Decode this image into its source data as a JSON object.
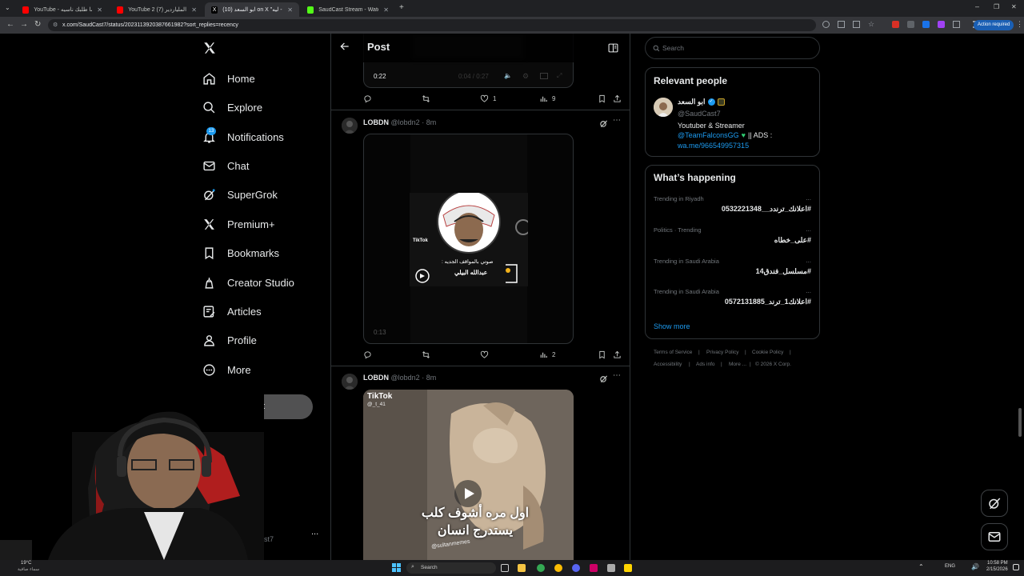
{
  "browser": {
    "tabs": [
      {
        "label": "YouTube - ما طلبك ناسيه",
        "active": false,
        "icon": "youtube-icon"
      },
      {
        "label": "YouTube 2 (7) تحدي الملياردير -",
        "active": false,
        "icon": "youtube-icon"
      },
      {
        "label": "ابو السعد (10) on X \"ميمز - ليه...",
        "active": true,
        "icon": "x-icon"
      },
      {
        "label": "SaudCast Stream - Watch Live -",
        "active": false,
        "icon": "kick-icon"
      }
    ],
    "url": "x.com/SaudCast7/status/2023113920387661982?sort_replies=recency",
    "action_required": "Action required"
  },
  "nav": {
    "items": [
      {
        "label": "Home",
        "icon": "home-icon"
      },
      {
        "label": "Explore",
        "icon": "search-icon"
      },
      {
        "label": "Notifications",
        "icon": "bell-icon"
      },
      {
        "label": "Chat",
        "icon": "mail-icon"
      },
      {
        "label": "SuperGrok",
        "icon": "grok-icon"
      },
      {
        "label": "Premium+",
        "icon": "x-logo-icon"
      },
      {
        "label": "Bookmarks",
        "icon": "bookmark-icon"
      },
      {
        "label": "Creator Studio",
        "icon": "creator-icon"
      },
      {
        "label": "Articles",
        "icon": "articles-icon"
      },
      {
        "label": "Profile",
        "icon": "person-icon"
      },
      {
        "label": "More",
        "icon": "more-circle-icon"
      }
    ],
    "notifications_badge": "13",
    "post_button": "Post",
    "account_handle_fragment": "st7",
    "account_more": "..."
  },
  "main": {
    "header_title": "Post",
    "first_video": {
      "time_left": "0:22",
      "time_progress": "0:04 / 0:27"
    },
    "first_actions": {
      "reply": "",
      "repost": "",
      "likes": "1",
      "views": "9"
    },
    "posts": [
      {
        "name": "LOBDN",
        "handle": "@lobdn2",
        "time": "· 8m",
        "video_time": "0:13",
        "overlay_tiktok": "TikTok",
        "overlay_caption": "صوتي بالمواقف الجديه :",
        "overlay_name": "عبدالله البيلي",
        "actions": {
          "likes": "",
          "views": "2"
        }
      },
      {
        "name": "LOBDN",
        "handle": "@lobdn2",
        "time": "· 8m",
        "overlay_tiktok": "TikTok",
        "overlay_user": "@_t_41",
        "caption_line1": "اول مره أشوف كلب",
        "caption_line2": "يستدرج انسان",
        "watermark": "@sultanmemes"
      }
    ]
  },
  "sidebar": {
    "search_placeholder": "Search",
    "relevant": {
      "title": "Relevant people",
      "name": "ابو السعد",
      "handle": "@SaudCast7",
      "bio_line1": "Youtuber & Streamer",
      "bio_mention": "@TeamFalconsGG",
      "bio_ads": "|| ADS :",
      "bio_link": "wa.me/966549957315"
    },
    "happening": {
      "title": "What’s happening",
      "trends": [
        {
          "meta": "Trending in Riyadh",
          "name": "#اعلانك_ترندد__0532221348"
        },
        {
          "meta": "Politics · Trending",
          "name": "#على_خطاه"
        },
        {
          "meta": "Trending in Saudi Arabia",
          "name": "#مسلسل_فندق14"
        },
        {
          "meta": "Trending in Saudi Arabia",
          "name": "#اعلانك1_ترند_0572131885"
        }
      ],
      "show_more": "Show more",
      "more_glyph": "..."
    },
    "footer": {
      "links": [
        "Terms of Service",
        "Privacy Policy",
        "Cookie Policy",
        "Accessibility",
        "Ads info",
        "More ..."
      ],
      "copyright": "© 2026 X Corp.",
      "divider": "|"
    }
  },
  "taskbar": {
    "search": "Search",
    "weather": "19°C",
    "weather_sub": "سماء صافية",
    "lang": "ENG",
    "time": "10:58 PM",
    "date": "2/15/2026"
  },
  "colors": {
    "accent": "#1d9bf0",
    "background": "#000000",
    "border": "#2f3336",
    "muted": "#71767b"
  }
}
